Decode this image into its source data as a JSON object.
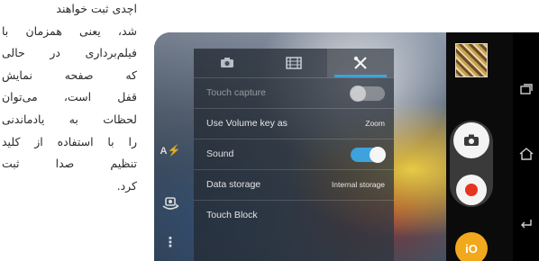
{
  "article": {
    "lines": [
      "اچدی ثبت خواهند",
      "شد، یعنی همزمان با",
      "فیلم‌برداری در حالی",
      "که صفحه نمایش",
      "قفل است، می‌توان",
      "لحظات به یادماندنی",
      "را با استفاده از کلید",
      "تنظیم صدا ثبت",
      "کرد."
    ]
  },
  "camera": {
    "left_bar": {
      "auto_label": "A"
    },
    "settings": {
      "tabs": [
        {
          "icon": "camera-icon",
          "active": false
        },
        {
          "icon": "video-icon",
          "active": false
        },
        {
          "icon": "tools-icon",
          "active": true
        }
      ],
      "rows": [
        {
          "label": "Touch capture",
          "control": "toggle",
          "state": "off",
          "dim": true
        },
        {
          "label": "Use Volume key as",
          "value": "Zoom"
        },
        {
          "label": "Sound",
          "control": "toggle",
          "state": "on"
        },
        {
          "label": "Data storage",
          "value": "Internal storage"
        },
        {
          "label": "Touch Block"
        }
      ]
    },
    "controls": {
      "mode_badge": "iO",
      "record_color": "#e53520",
      "mode_color": "#f2a81c",
      "accent": "#3aa6e6"
    }
  }
}
